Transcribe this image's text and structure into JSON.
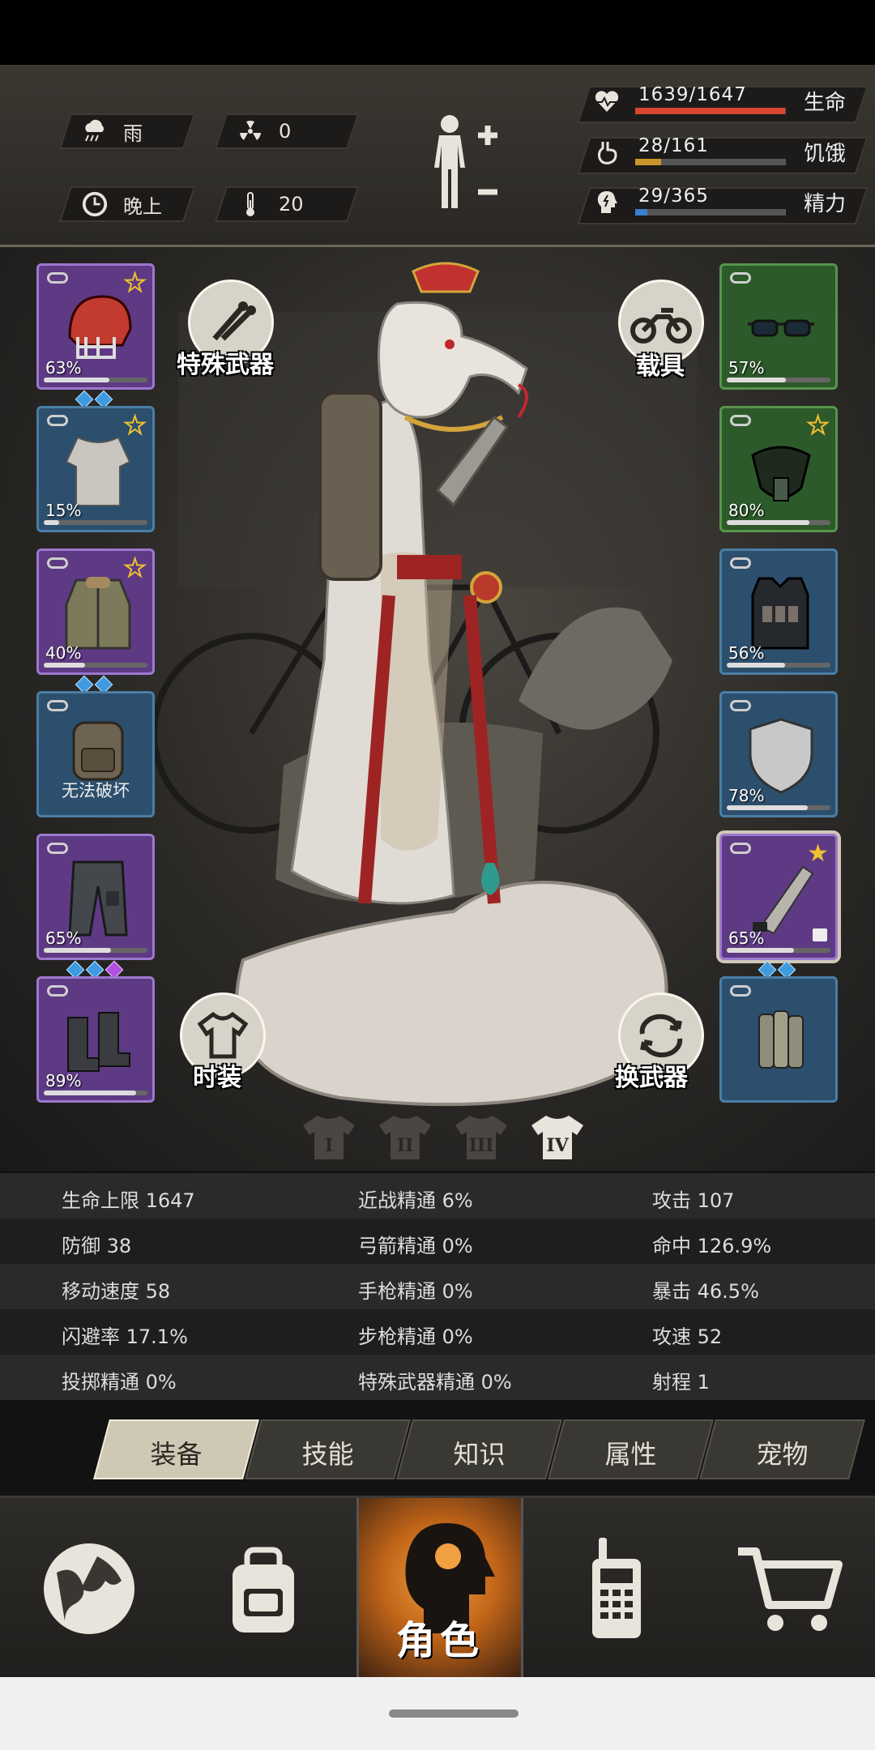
{
  "header": {
    "weather": {
      "label": "雨",
      "icon": "rain-cloud-icon"
    },
    "radiation": {
      "value": "0",
      "icon": "radiation-icon"
    },
    "time": {
      "label": "晚上",
      "icon": "clock-icon"
    },
    "temperature": {
      "value": "20",
      "icon": "thermometer-icon"
    },
    "health": {
      "value": "1639/1647",
      "label": "生命",
      "fraction": 0.995,
      "color": "#d8452f"
    },
    "hunger": {
      "value": "28/161",
      "label": "饥饿",
      "fraction": 0.174,
      "color": "#c8962a"
    },
    "energy": {
      "value": "29/365",
      "label": "精力",
      "fraction": 0.079,
      "color": "#3a7fd0"
    }
  },
  "scene": {
    "special_weapon_label": "特殊武器",
    "vehicle_label": "载具",
    "outfit_label": "时装",
    "swap_weapon_label": "换武器",
    "outfit_tabs": [
      "I",
      "II",
      "III",
      "IV"
    ],
    "active_outfit_tab": "IV"
  },
  "left_slots": [
    {
      "name": "helmet",
      "pct": "63%",
      "durability": 0.63,
      "rarity": "purple",
      "star": true,
      "gems": [
        "blue",
        "blue"
      ]
    },
    {
      "name": "shirt",
      "pct": "15%",
      "durability": 0.15,
      "rarity": "blue",
      "star": true,
      "gems": []
    },
    {
      "name": "jacket",
      "pct": "40%",
      "durability": 0.4,
      "rarity": "purple",
      "star": true,
      "gems": [
        "blue",
        "blue"
      ]
    },
    {
      "name": "backpack",
      "label": "无法破坏",
      "rarity": "blue",
      "star": false,
      "gems": []
    },
    {
      "name": "pants",
      "pct": "65%",
      "durability": 0.65,
      "rarity": "purple",
      "star": false,
      "gems": [
        "blue",
        "blue",
        "purple"
      ]
    },
    {
      "name": "boots",
      "pct": "89%",
      "durability": 0.89,
      "rarity": "purple",
      "star": false,
      "gems": []
    }
  ],
  "right_slots": [
    {
      "name": "goggles",
      "pct": "57%",
      "durability": 0.57,
      "rarity": "green",
      "star": false,
      "gems": []
    },
    {
      "name": "gas-mask",
      "pct": "80%",
      "durability": 0.8,
      "rarity": "green",
      "star": true,
      "gems": []
    },
    {
      "name": "vest",
      "pct": "56%",
      "durability": 0.56,
      "rarity": "blue",
      "star": false,
      "gems": []
    },
    {
      "name": "shield",
      "pct": "78%",
      "durability": 0.78,
      "rarity": "blue",
      "star": false,
      "gems": []
    },
    {
      "name": "machete",
      "pct": "65%",
      "durability": 0.65,
      "rarity": "purple",
      "star": true,
      "filled_star": true,
      "locked": true,
      "gems": [
        "blue",
        "blue"
      ]
    },
    {
      "name": "explosive",
      "rarity": "blue",
      "star": false,
      "gems": []
    }
  ],
  "stats": [
    [
      "生命上限 1647",
      "近战精通 6%",
      "攻击 107"
    ],
    [
      "防御 38",
      "弓箭精通 0%",
      "命中 126.9%"
    ],
    [
      "移动速度 58",
      "手枪精通 0%",
      "暴击 46.5%"
    ],
    [
      "闪避率 17.1%",
      "步枪精通 0%",
      "攻速 52"
    ],
    [
      "投掷精通 0%",
      "特殊武器精通 0%",
      "射程 1"
    ]
  ],
  "subtabs": [
    "装备",
    "技能",
    "知识",
    "属性",
    "宠物"
  ],
  "active_subtab": "装备",
  "bottom_nav": [
    {
      "name": "world-map",
      "icon": "globe-icon"
    },
    {
      "name": "inventory",
      "icon": "backpack-icon"
    },
    {
      "name": "character",
      "icon": "character-head-icon",
      "label": "角色",
      "active": true
    },
    {
      "name": "radio",
      "icon": "walkie-talkie-icon"
    },
    {
      "name": "shop",
      "icon": "shopping-cart-icon"
    }
  ]
}
